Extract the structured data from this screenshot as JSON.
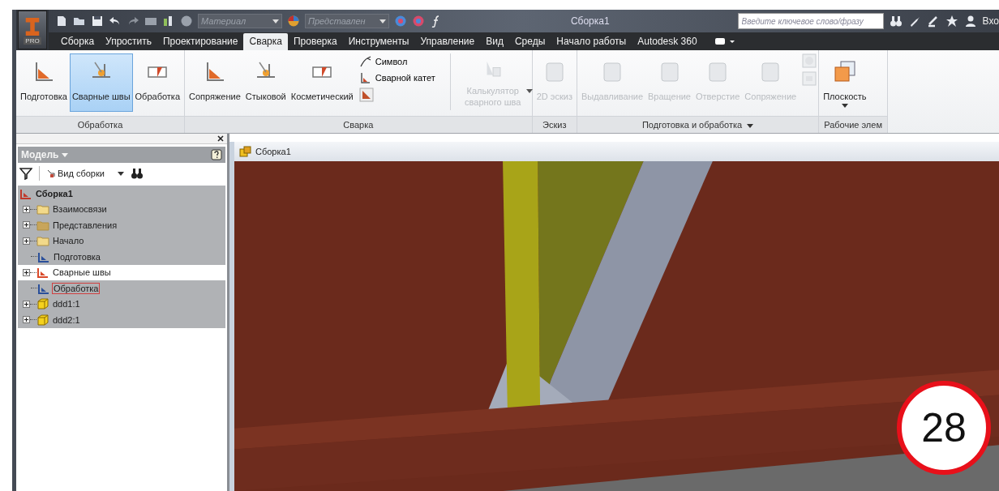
{
  "app_button": {
    "badge": "PRO"
  },
  "quick_access": {
    "material": "Материал",
    "appearance": "Представлен"
  },
  "window": {
    "title": "Сборка1"
  },
  "search": {
    "placeholder": "Введите ключевое слово/фразу"
  },
  "sign_in": "Вхо",
  "tabs": [
    {
      "label": "Сборка",
      "selected": false
    },
    {
      "label": "Упростить",
      "selected": false
    },
    {
      "label": "Проектирование",
      "selected": false
    },
    {
      "label": "Сварка",
      "selected": true
    },
    {
      "label": "Проверка",
      "selected": false
    },
    {
      "label": "Инструменты",
      "selected": false
    },
    {
      "label": "Управление",
      "selected": false
    },
    {
      "label": "Вид",
      "selected": false
    },
    {
      "label": "Среды",
      "selected": false
    },
    {
      "label": "Начало работы",
      "selected": false
    },
    {
      "label": "Autodesk 360",
      "selected": false
    }
  ],
  "ribbon": {
    "panels": [
      {
        "label": "Обработка",
        "has_menu": false,
        "buttons": [
          {
            "label": "Подготовка",
            "selected": false,
            "disabled": false,
            "dropdown": false
          },
          {
            "label": "Сварные швы",
            "selected": true,
            "disabled": false,
            "dropdown": false
          },
          {
            "label": "Обработка",
            "selected": false,
            "disabled": false,
            "dropdown": false
          }
        ]
      },
      {
        "label": "Сварка",
        "has_menu": false,
        "buttons": [
          {
            "label": "Сопряжение",
            "selected": false,
            "disabled": false,
            "dropdown": false
          },
          {
            "label": "Стыковой",
            "selected": false,
            "disabled": false,
            "dropdown": false
          },
          {
            "label": "Косметический",
            "selected": false,
            "disabled": false,
            "dropdown": false
          }
        ],
        "small_buttons": [
          {
            "label": "Символ"
          },
          {
            "label": "Сварной катет"
          }
        ],
        "extra_buttons": [
          {
            "label": "Калькулятор сварного шва",
            "selected": false,
            "disabled": true,
            "dropdown": true
          }
        ]
      },
      {
        "label": "Эскиз",
        "has_menu": false,
        "buttons": [
          {
            "label": "2D эскиз",
            "selected": false,
            "disabled": true,
            "dropdown": false
          }
        ]
      },
      {
        "label": "Подготовка и обработка",
        "has_menu": true,
        "buttons": [
          {
            "label": "Выдавливание",
            "selected": false,
            "disabled": true,
            "dropdown": false
          },
          {
            "label": "Вращение",
            "selected": false,
            "disabled": true,
            "dropdown": false
          },
          {
            "label": "Отверстие",
            "selected": false,
            "disabled": true,
            "dropdown": false
          },
          {
            "label": "Сопряжение",
            "selected": false,
            "disabled": true,
            "dropdown": false
          }
        ]
      },
      {
        "label": "Рабочие элем",
        "has_menu": false,
        "buttons": [
          {
            "label": "Плоскость",
            "selected": false,
            "disabled": false,
            "dropdown": true
          }
        ]
      }
    ]
  },
  "model_panel": {
    "title": "Модель",
    "view": "Вид сборки",
    "tree": [
      {
        "label": "Сборка1",
        "kind": "assembly",
        "expandable": false,
        "greyed": true,
        "selected": false,
        "children": [
          {
            "label": "Взаимосвязи",
            "kind": "folder",
            "expandable": true,
            "greyed": true,
            "selected": false
          },
          {
            "label": "Представления",
            "kind": "representations",
            "expandable": true,
            "greyed": true,
            "selected": false
          },
          {
            "label": "Начало",
            "kind": "folder",
            "expandable": true,
            "greyed": true,
            "selected": false
          },
          {
            "label": "Подготовка",
            "kind": "preparation",
            "expandable": false,
            "greyed": true,
            "selected": false
          },
          {
            "label": "Сварные швы",
            "kind": "welds",
            "expandable": true,
            "greyed": false,
            "selected": false
          },
          {
            "label": "Обработка",
            "kind": "machining",
            "expandable": false,
            "greyed": true,
            "selected": true
          },
          {
            "label": "ddd1:1",
            "kind": "part",
            "expandable": true,
            "greyed": true,
            "selected": false
          },
          {
            "label": "ddd2:1",
            "kind": "part",
            "expandable": true,
            "greyed": true,
            "selected": false
          }
        ]
      }
    ]
  },
  "viewport": {
    "tab": "Сборка1"
  },
  "page_badge": "28"
}
